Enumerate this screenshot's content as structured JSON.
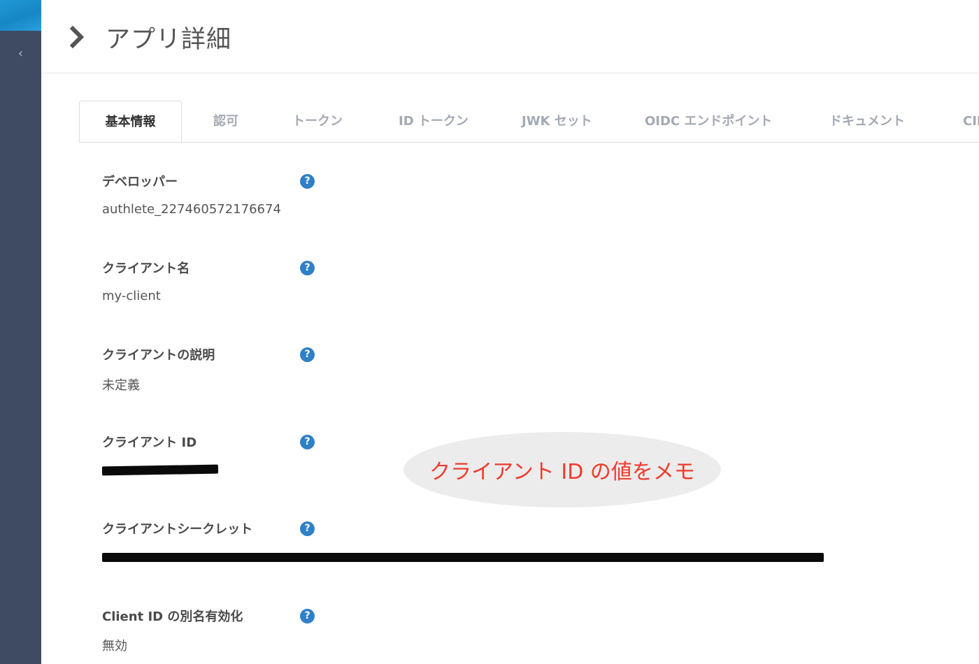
{
  "page": {
    "title": "アプリ詳細"
  },
  "sidebar": {
    "collapse_glyph": "‹"
  },
  "tabs": [
    {
      "label": "基本情報",
      "active": true
    },
    {
      "label": "認可",
      "active": false
    },
    {
      "label": "トークン",
      "active": false
    },
    {
      "label": "ID トークン",
      "active": false
    },
    {
      "label": "JWK セット",
      "active": false
    },
    {
      "label": "OIDC エンドポイント",
      "active": false
    },
    {
      "label": "ドキュメント",
      "active": false
    },
    {
      "label": "CIB",
      "active": false
    }
  ],
  "fields": {
    "developer": {
      "label": "デベロッパー",
      "value": "authlete_227460572176674"
    },
    "client_name": {
      "label": "クライアント名",
      "value": "my-client"
    },
    "client_description": {
      "label": "クライアントの説明",
      "value": "未定義"
    },
    "client_id": {
      "label": "クライアント ID",
      "value": "redacted"
    },
    "client_secret": {
      "label": "クライアントシークレット",
      "value": "redacted"
    },
    "client_id_alias": {
      "label": "Client ID の別名有効化",
      "value": "無効"
    }
  },
  "help_icon_glyph": "?",
  "annotation": {
    "text": "クライアント ID の値をメモ",
    "color": "#ef3b2d"
  },
  "colors": {
    "sidebar": "#3e4b63",
    "sidebar_accent": "#1f9ad6",
    "help_icon": "#2f80c6",
    "tab_inactive": "#a3a9b3"
  }
}
